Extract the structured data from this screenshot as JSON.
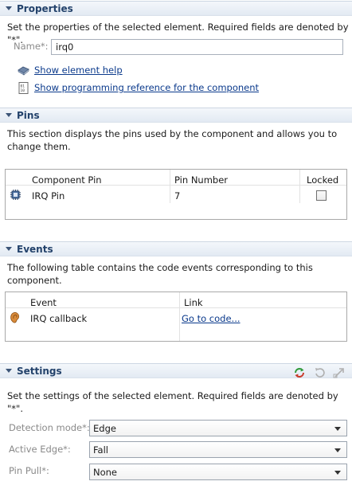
{
  "properties": {
    "header": "Properties",
    "description": "Set the properties of the selected element. Required fields are denoted by \"*\".",
    "name_label": "Name*:",
    "name_value": "irq0",
    "help_link": "Show element help",
    "reference_link": "Show programming reference for the component"
  },
  "pins": {
    "header": "Pins",
    "description": "This section displays the pins used by the component and allows you to change them.",
    "columns": [
      "Component Pin",
      "Pin Number",
      "Locked"
    ],
    "rows": [
      {
        "pin": "IRQ Pin",
        "number": "7",
        "locked": false
      }
    ]
  },
  "events": {
    "header": "Events",
    "description": "The following table contains the code events corresponding to this component.",
    "columns": [
      "Event",
      "Link"
    ],
    "rows": [
      {
        "event": "IRQ callback",
        "link": "Go to code..."
      }
    ]
  },
  "settings": {
    "header": "Settings",
    "description": "Set the settings of the selected element. Required fields are denoted by \"*\".",
    "fields": [
      {
        "label": "Detection mode*:",
        "value": "Edge"
      },
      {
        "label": "Active Edge*:",
        "value": "Fall"
      },
      {
        "label": "Pin Pull*:",
        "value": "None"
      }
    ]
  },
  "colors": {
    "header_text": "#23426b",
    "link": "#0b3a8c",
    "disabled_label": "#8a8a8a"
  }
}
